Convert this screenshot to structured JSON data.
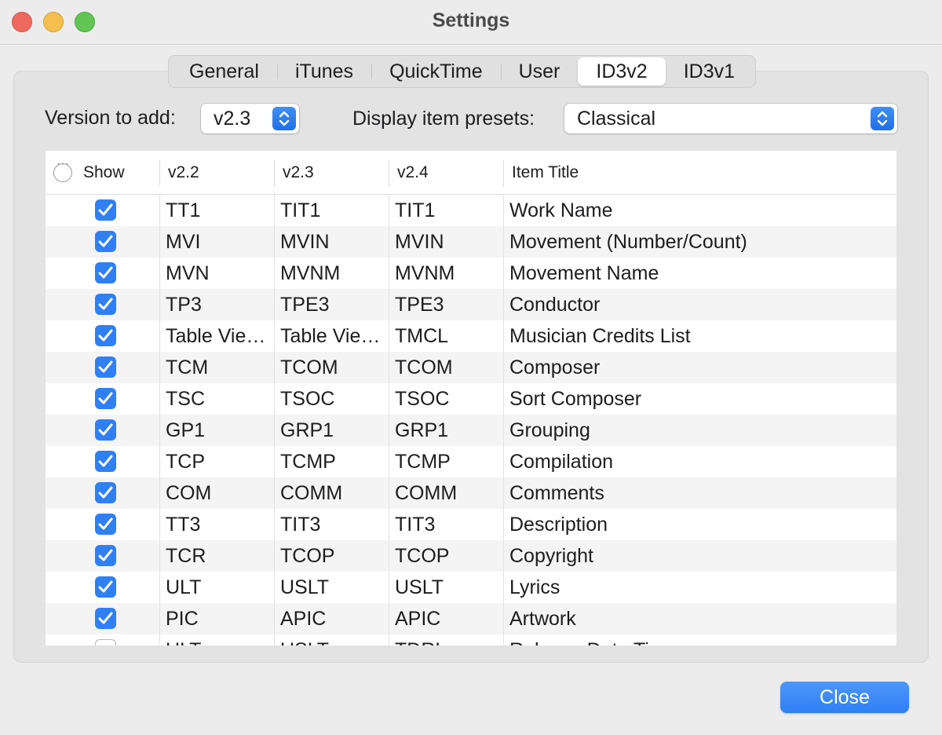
{
  "window": {
    "title": "Settings"
  },
  "tabs": [
    "General",
    "iTunes",
    "QuickTime",
    "User",
    "ID3v2",
    "ID3v1"
  ],
  "active_tab": "ID3v2",
  "version": {
    "label": "Version to add:",
    "value": "v2.3"
  },
  "presets": {
    "label": "Display item presets:",
    "value": "Classical"
  },
  "table": {
    "columns": [
      "Show",
      "v2.2",
      "v2.3",
      "v2.4",
      "Item Title"
    ],
    "rows": [
      {
        "show": true,
        "v22": "TT1",
        "v23": "TIT1",
        "v24": "TIT1",
        "title": "Work Name"
      },
      {
        "show": true,
        "v22": "MVI",
        "v23": "MVIN",
        "v24": "MVIN",
        "title": "Movement (Number/Count)"
      },
      {
        "show": true,
        "v22": "MVN",
        "v23": "MVNM",
        "v24": "MVNM",
        "title": "Movement Name"
      },
      {
        "show": true,
        "v22": "TP3",
        "v23": "TPE3",
        "v24": "TPE3",
        "title": "Conductor"
      },
      {
        "show": true,
        "v22": "Table Vie…",
        "v23": "Table Vie…",
        "v24": "TMCL",
        "title": "Musician Credits List"
      },
      {
        "show": true,
        "v22": "TCM",
        "v23": "TCOM",
        "v24": "TCOM",
        "title": "Composer"
      },
      {
        "show": true,
        "v22": "TSC",
        "v23": "TSOC",
        "v24": "TSOC",
        "title": "Sort Composer"
      },
      {
        "show": true,
        "v22": "GP1",
        "v23": "GRP1",
        "v24": "GRP1",
        "title": "Grouping"
      },
      {
        "show": true,
        "v22": "TCP",
        "v23": "TCMP",
        "v24": "TCMP",
        "title": "Compilation"
      },
      {
        "show": true,
        "v22": "COM",
        "v23": "COMM",
        "v24": "COMM",
        "title": "Comments"
      },
      {
        "show": true,
        "v22": "TT3",
        "v23": "TIT3",
        "v24": "TIT3",
        "title": "Description"
      },
      {
        "show": true,
        "v22": "TCR",
        "v23": "TCOP",
        "v24": "TCOP",
        "title": "Copyright"
      },
      {
        "show": true,
        "v22": "ULT",
        "v23": "USLT",
        "v24": "USLT",
        "title": "Lyrics"
      },
      {
        "show": true,
        "v22": "PIC",
        "v23": "APIC",
        "v24": "APIC",
        "title": "Artwork"
      },
      {
        "show": false,
        "v22": "ULT",
        "v23": "USLT",
        "v24": "TDRL",
        "title": "Release Date Time"
      }
    ]
  },
  "buttons": {
    "close": "Close"
  },
  "colors": {
    "accent": "#2f7ff5",
    "window_bg": "#ececec"
  }
}
